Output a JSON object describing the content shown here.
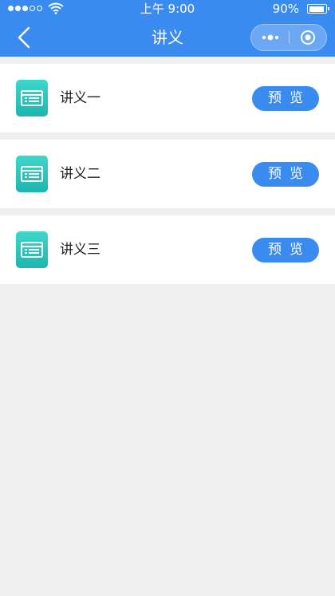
{
  "status_bar": {
    "time": "上午 9:00",
    "battery_percent": "90%",
    "battery_level": 0.9,
    "signal_bars_filled": 3,
    "signal_bars_total": 5
  },
  "nav": {
    "title": "讲义",
    "back_icon": "chevron-left-icon",
    "more_icon": "more-dots-icon",
    "close_icon": "target-circle-icon"
  },
  "colors": {
    "primary": "#3a8bf0",
    "icon_teal": "#2cc6bd",
    "background": "#efefef"
  },
  "items": [
    {
      "title": "讲义一",
      "action_label": "预览",
      "icon": "document-icon"
    },
    {
      "title": "讲义二",
      "action_label": "预览",
      "icon": "document-icon"
    },
    {
      "title": "讲义三",
      "action_label": "预览",
      "icon": "document-icon"
    }
  ]
}
